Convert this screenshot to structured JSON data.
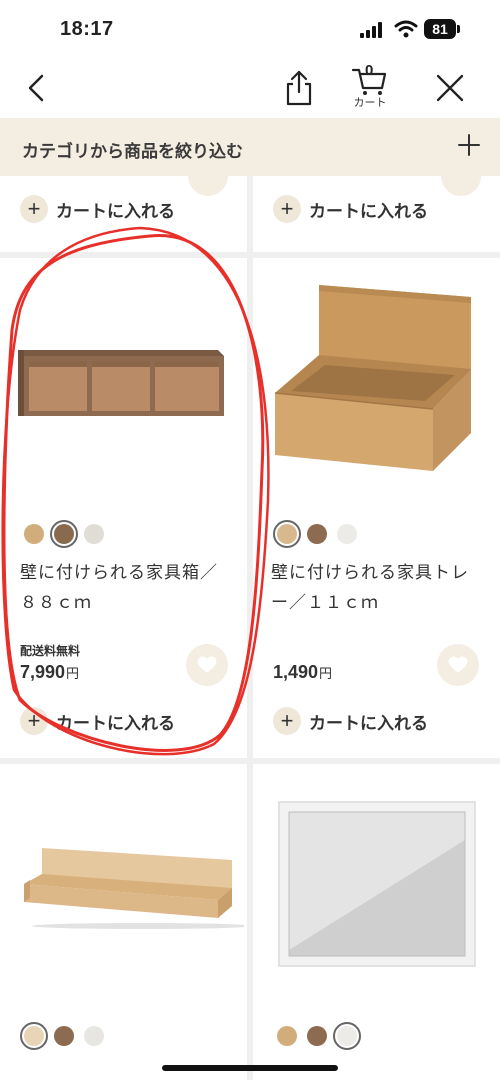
{
  "status_bar": {
    "time": "18:17",
    "battery": "81"
  },
  "nav": {
    "cart_count": "0",
    "cart_label": "カート"
  },
  "filter": {
    "label": "カテゴリから商品を絞り込む"
  },
  "top_row": {
    "left_add_cart": "カートに入れる",
    "right_add_cart": "カートに入れる"
  },
  "products": [
    {
      "name_line1": "壁に付けられる家具箱／",
      "name_line2": "８８ｃｍ",
      "shipping": "配送料無料",
      "price": "7,990",
      "currency": "円",
      "add_cart": "カートに入れる",
      "swatches": [
        "#d2ad7c",
        "#8a6a4f",
        "#e0ddd6"
      ],
      "selected_swatch": 1
    },
    {
      "name_line1": "壁に付けられる家具トレ",
      "name_line2": "ー／１１ｃｍ",
      "price": "1,490",
      "currency": "円",
      "add_cart": "カートに入れる",
      "swatches": [
        "#d8b98f",
        "#8d6b50",
        "#ecebe8"
      ],
      "selected_swatch": 0
    }
  ],
  "bottom_row": {
    "left_swatches": [
      "#e8d5b8",
      "#8d6b50",
      "#e7e6e3"
    ],
    "right_swatches": [
      "#d2ad7c",
      "#8d6b50",
      "#ecebe8"
    ]
  },
  "icons": {
    "back": "chevron-left-icon",
    "share": "share-icon",
    "cart": "cart-icon",
    "close": "close-icon",
    "plus": "plus-icon",
    "favorite": "heart-icon"
  },
  "colors": {
    "filter_bg": "#f4ede1",
    "grid_gap": "#efefef",
    "annotation": "#e8302a"
  }
}
